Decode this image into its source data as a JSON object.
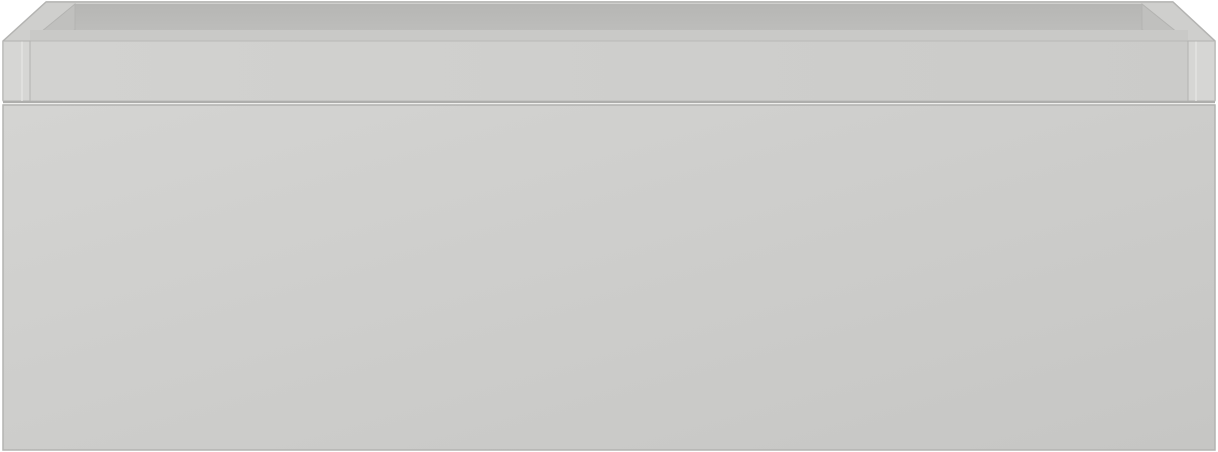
{
  "object": {
    "kind": "drawer-unit",
    "colors": {
      "body_light": "#d3d3d1",
      "body_dark": "#c6c6c4",
      "rim_top": "#cdcdcb",
      "inner_back": "#b9b9b7",
      "inner_side": "#c2c2c0",
      "interior": "#d0d0ce",
      "edge_light": "#e6e6e4",
      "outline": "#b0b0ae",
      "seam": "#a9a9a7"
    }
  }
}
